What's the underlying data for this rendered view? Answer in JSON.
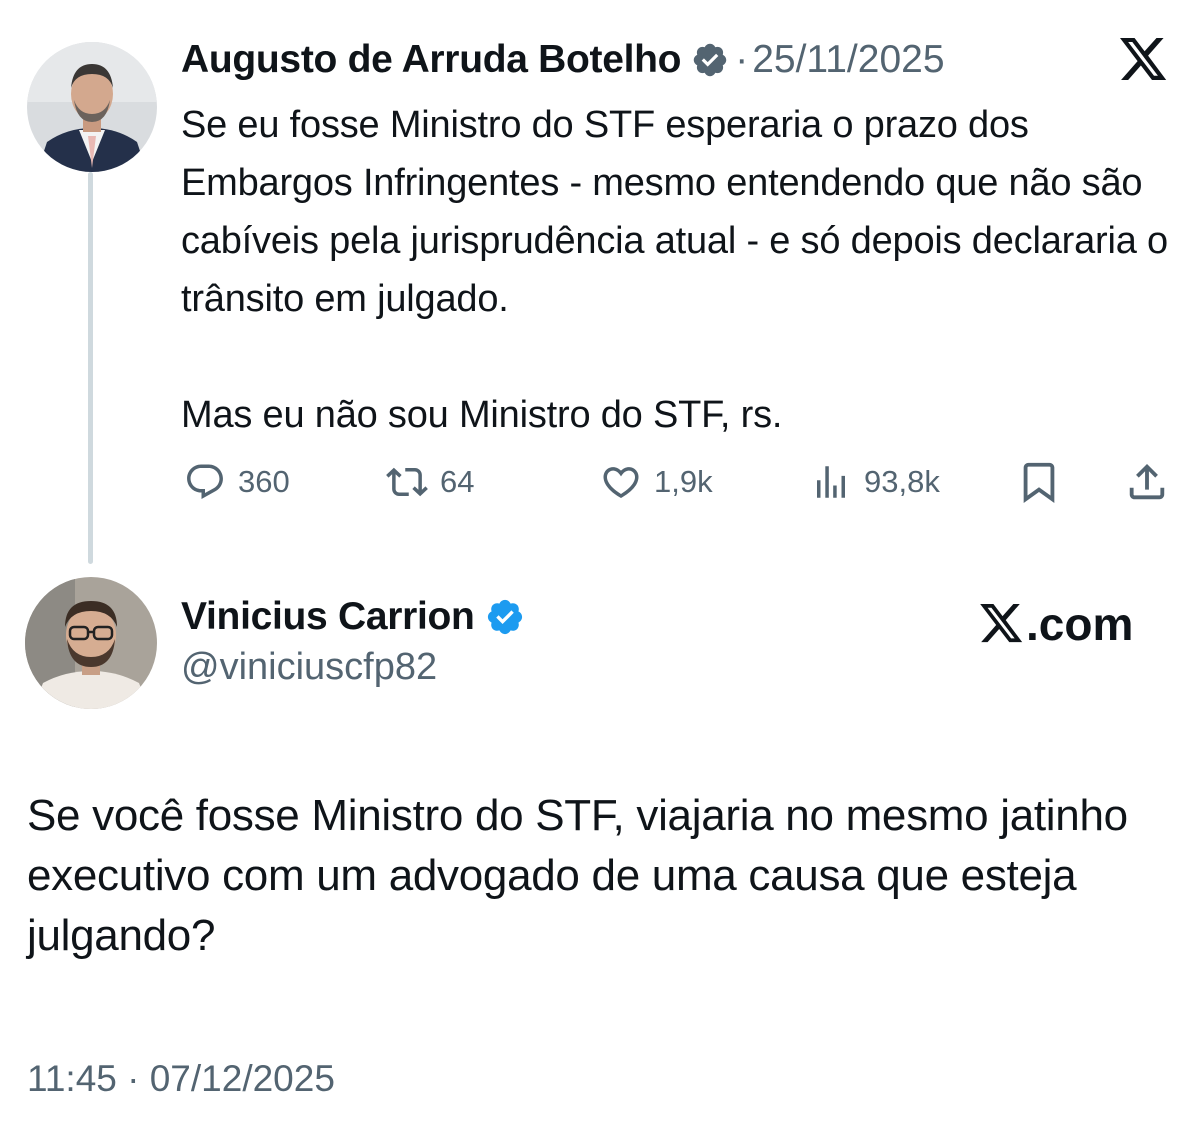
{
  "quoted_tweet": {
    "author_name": "Augusto de Arruda Botelho",
    "separator": "·",
    "date": "25/11/2025",
    "text_paragraph_1": "Se eu fosse Ministro do STF esperaria o prazo dos Embargos Infringentes - mesmo entendendo que não são cabíveis pela jurisprudência atual - e só depois declararia o trânsito em julgado.",
    "text_paragraph_2": "Mas eu não sou Ministro do STF, rs.",
    "metrics": {
      "replies": "360",
      "reposts": "64",
      "likes": "1,9k",
      "views": "93,8k"
    },
    "icons": [
      "verified-badge-icon",
      "x-logo-icon",
      "reply-icon",
      "repost-icon",
      "like-icon",
      "views-icon",
      "bookmark-icon",
      "share-icon"
    ],
    "badge_color": "#536471"
  },
  "main_tweet": {
    "author_name": "Vinicius Carrion",
    "handle": "@viniciuscfp82",
    "watermark": ".com",
    "text": "Se você fosse Ministro do STF, viajaria no mesmo jatinho executivo com um advogado de uma causa que esteja julgando?",
    "timestamp": "11:45 · 07/12/2025",
    "badge_color": "#1d9bf0"
  },
  "colors": {
    "text": "#0f1419",
    "secondary": "#536471",
    "thread_line": "#cfd9de"
  }
}
